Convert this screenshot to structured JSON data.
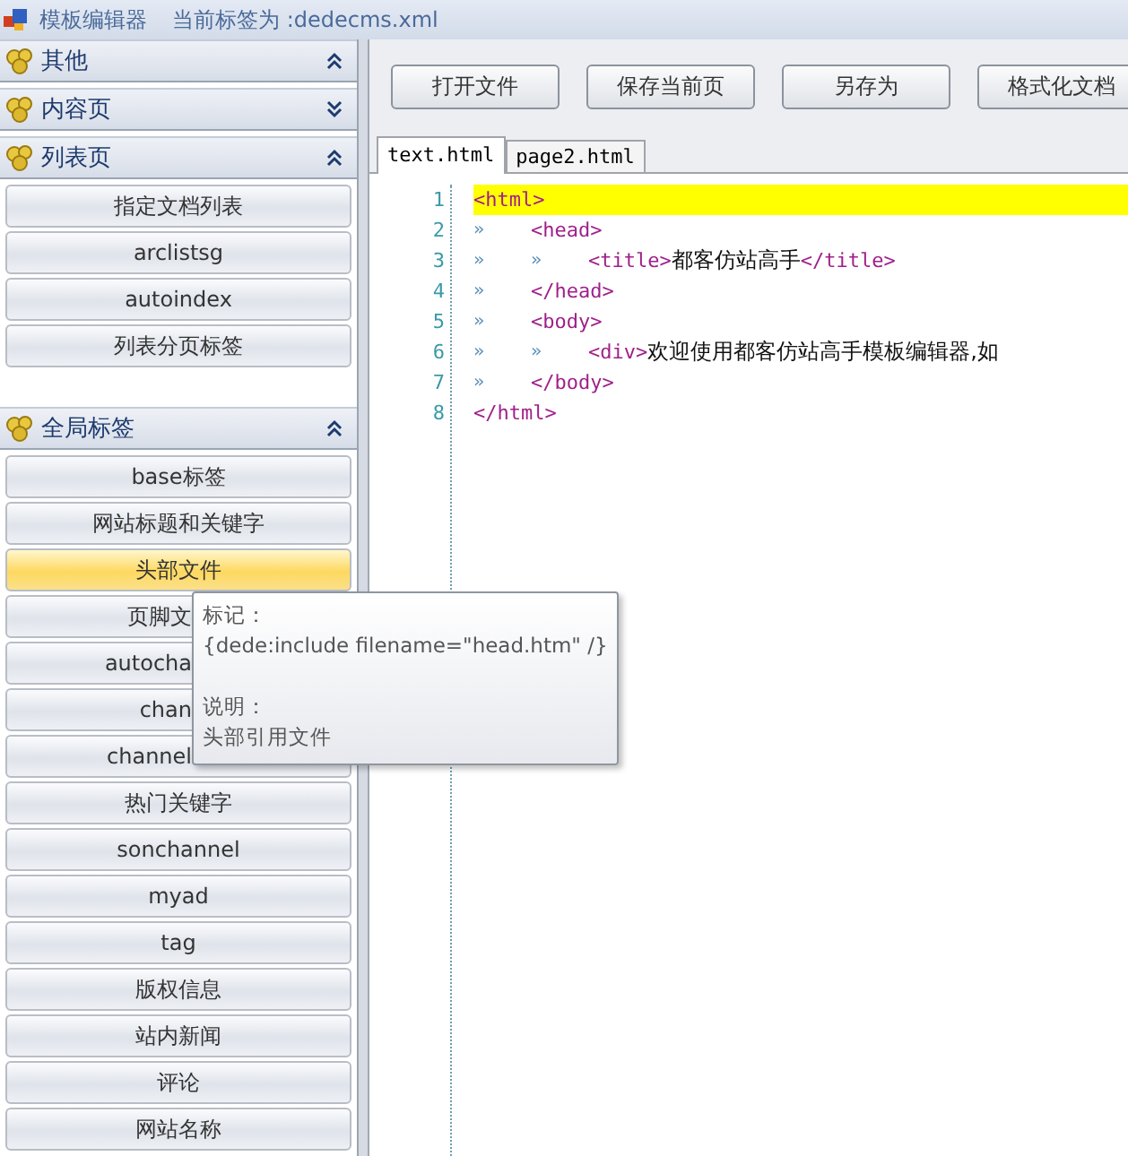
{
  "window": {
    "title": "模板编辑器",
    "subtitle": "当前标签为 :dedecms.xml"
  },
  "sidebar": {
    "groups": [
      {
        "label": "其他",
        "expanded": true
      },
      {
        "label": "内容页",
        "expanded": false
      },
      {
        "label": "列表页",
        "expanded": true,
        "items": [
          {
            "label": "指定文档列表",
            "selected": false,
            "covered": false
          },
          {
            "label": "arclistsg",
            "selected": false,
            "covered": false
          },
          {
            "label": "autoindex",
            "selected": false,
            "covered": false
          },
          {
            "label": "列表分页标签",
            "selected": false,
            "covered": false
          }
        ]
      },
      {
        "label": "全局标签",
        "expanded": true,
        "items": [
          {
            "label": "base标签",
            "selected": false,
            "covered": false
          },
          {
            "label": "网站标题和关键字",
            "selected": false,
            "covered": false
          },
          {
            "label": "头部文件",
            "selected": true,
            "covered": false
          },
          {
            "label": "页脚文",
            "selected": false,
            "covered": true
          },
          {
            "label": "autocha",
            "selected": false,
            "covered": true
          },
          {
            "label": "chan",
            "selected": false,
            "covered": true
          },
          {
            "label": "channel",
            "selected": false,
            "covered": true
          },
          {
            "label": "热门关键字",
            "selected": false,
            "covered": false
          },
          {
            "label": "sonchannel",
            "selected": false,
            "covered": false
          },
          {
            "label": "myad",
            "selected": false,
            "covered": false
          },
          {
            "label": "tag",
            "selected": false,
            "covered": false
          },
          {
            "label": "版权信息",
            "selected": false,
            "covered": false
          },
          {
            "label": "站内新闻",
            "selected": false,
            "covered": false
          },
          {
            "label": "评论",
            "selected": false,
            "covered": false
          },
          {
            "label": "网站名称",
            "selected": false,
            "covered": false
          }
        ]
      }
    ]
  },
  "tooltip": {
    "lines": [
      "标记：",
      "{dede:include filename=\"head.htm\" /}",
      "说明：",
      "头部引用文件"
    ]
  },
  "toolbar": {
    "buttons": [
      "打开文件",
      "保存当前页",
      "另存为",
      "格式化文档"
    ]
  },
  "tabs": [
    {
      "label": "text.html",
      "selected": true
    },
    {
      "label": "page2.html",
      "selected": false
    }
  ],
  "editor": {
    "lines": [
      {
        "number": "1",
        "highlighted": true,
        "tokens": [
          {
            "kind": "tag",
            "text": "<html>"
          }
        ]
      },
      {
        "number": "2",
        "highlighted": false,
        "marks": [
          "»"
        ],
        "tokens": [
          {
            "kind": "tag",
            "text": "<head>"
          }
        ]
      },
      {
        "number": "3",
        "highlighted": false,
        "marks": [
          "»",
          "»"
        ],
        "tokens": [
          {
            "kind": "tag",
            "text": "<title>"
          },
          {
            "kind": "text",
            "text": "都客仿站高手"
          },
          {
            "kind": "tag",
            "text": "</title>"
          }
        ]
      },
      {
        "number": "4",
        "highlighted": false,
        "marks": [
          "»"
        ],
        "tokens": [
          {
            "kind": "tag",
            "text": "</head>"
          }
        ]
      },
      {
        "number": "5",
        "highlighted": false,
        "marks": [
          "»"
        ],
        "tokens": [
          {
            "kind": "tag",
            "text": "<body>"
          }
        ]
      },
      {
        "number": "6",
        "highlighted": false,
        "marks": [
          "»",
          "»"
        ],
        "tokens": [
          {
            "kind": "tag",
            "text": "<div>"
          },
          {
            "kind": "text",
            "text": "欢迎使用都客仿站高手模板编辑器,如"
          }
        ]
      },
      {
        "number": "7",
        "highlighted": false,
        "marks": [
          "»"
        ],
        "tokens": [
          {
            "kind": "tag",
            "text": "</body>"
          }
        ]
      },
      {
        "number": "8",
        "highlighted": false,
        "tokens": [
          {
            "kind": "tag",
            "text": "</html>"
          }
        ]
      }
    ]
  }
}
